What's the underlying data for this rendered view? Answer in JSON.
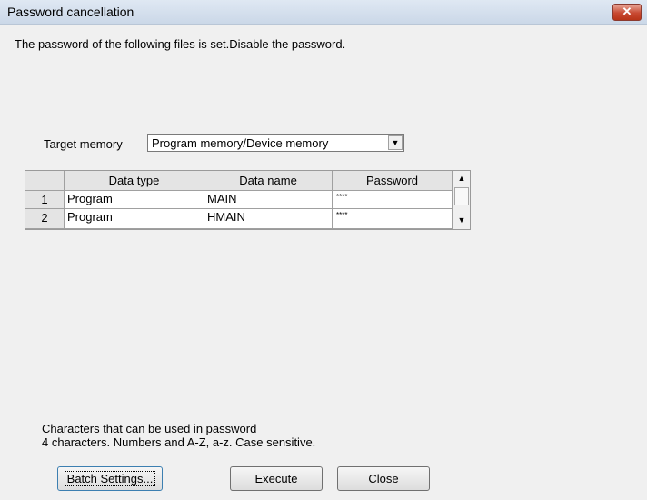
{
  "window": {
    "title": "Password cancellation",
    "close_symbol": "✕"
  },
  "message": "The password of the following files is set.Disable the password.",
  "target_memory": {
    "label": "Target memory",
    "value": "Program memory/Device memory",
    "arrow": "▼"
  },
  "table": {
    "columns": [
      "",
      "Data type",
      "Data name",
      "Password"
    ],
    "rows": [
      {
        "num": "1",
        "data_type": "Program",
        "data_name": "MAIN",
        "password": "****"
      },
      {
        "num": "2",
        "data_type": "Program",
        "data_name": "HMAIN",
        "password": "****"
      }
    ],
    "scroll_up": "▲",
    "scroll_down": "▼"
  },
  "info": {
    "line1": "Characters that can be used in password",
    "line2": " 4 characters. Numbers and A-Z, a-z. Case sensitive."
  },
  "buttons": {
    "batch": "Batch Settings...",
    "execute": "Execute",
    "close": "Close"
  }
}
